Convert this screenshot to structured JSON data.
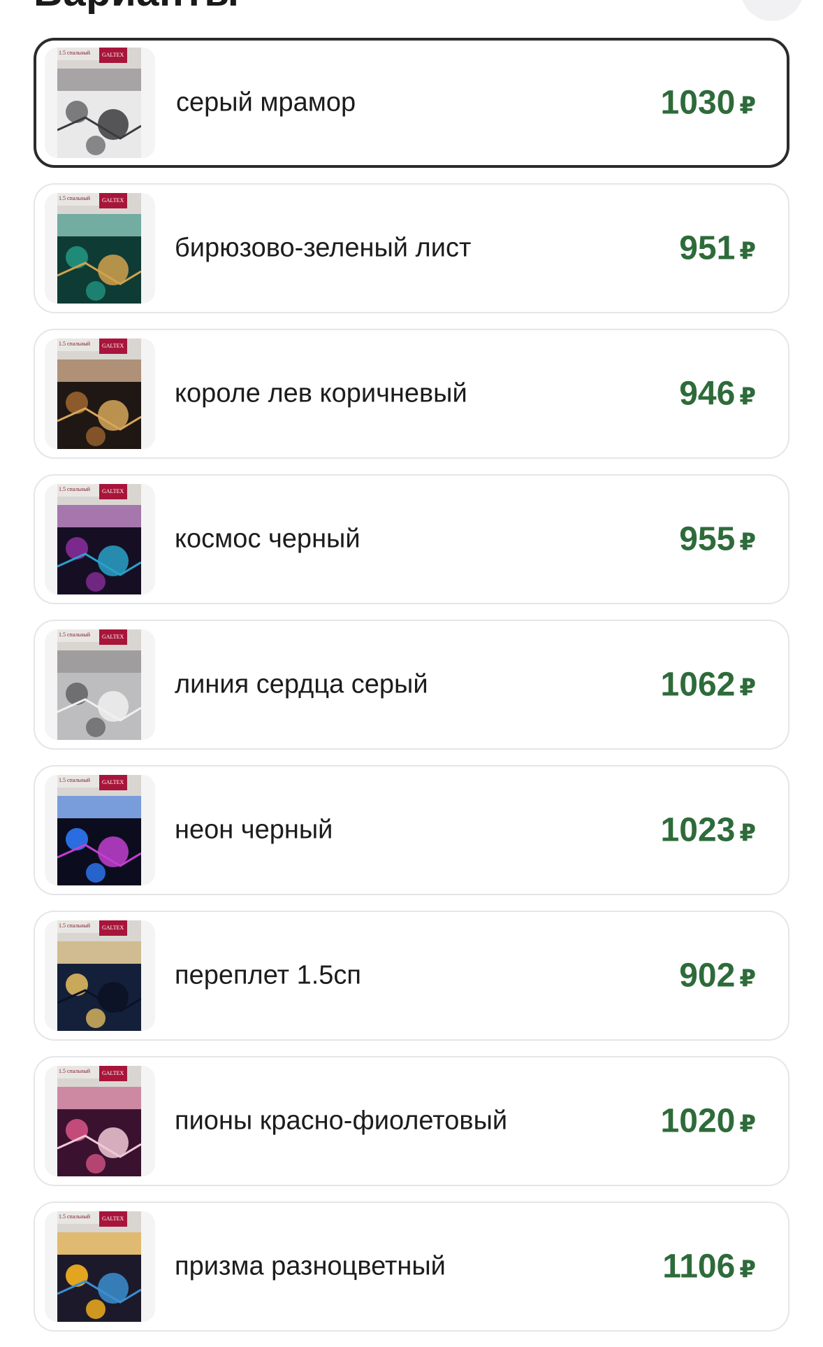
{
  "header": {
    "title": "Варианты"
  },
  "currency_symbol": "₽",
  "variants": [
    {
      "name": "серый мрамор",
      "price": "1030",
      "selected": true,
      "swatch": "gray-marble",
      "colors": [
        "#e9e9ea",
        "#7b7b7e",
        "#3b3b3e"
      ]
    },
    {
      "name": "бирюзово-зеленый лист",
      "price": "951",
      "selected": false,
      "swatch": "teal-leaf",
      "colors": [
        "#0f3b35",
        "#1f8a78",
        "#d2a24c"
      ]
    },
    {
      "name": "короле лев коричневый",
      "price": "946",
      "selected": false,
      "swatch": "lion-brown",
      "colors": [
        "#1f1714",
        "#8c5a2b",
        "#d7a75a"
      ]
    },
    {
      "name": "космос черный",
      "price": "955",
      "selected": false,
      "swatch": "cosmos-black",
      "colors": [
        "#160f24",
        "#7a2a8c",
        "#2aa1c9"
      ]
    },
    {
      "name": "линия сердца серый",
      "price": "1062",
      "selected": false,
      "swatch": "heart-gray",
      "colors": [
        "#bdbdbf",
        "#6f6f72",
        "#f0f0f0"
      ]
    },
    {
      "name": "неон черный",
      "price": "1023",
      "selected": false,
      "swatch": "neon-black",
      "colors": [
        "#0b0d1e",
        "#2a6de0",
        "#c23fd0"
      ]
    },
    {
      "name": "переплет 1.5сп",
      "price": "902",
      "selected": false,
      "swatch": "lattice-navy",
      "colors": [
        "#14203a",
        "#c9a85a",
        "#0b1224"
      ]
    },
    {
      "name": "пионы красно-фиолетовый",
      "price": "1020",
      "selected": false,
      "swatch": "peony-purple",
      "colors": [
        "#3a1230",
        "#c24b7a",
        "#f1c9d6"
      ]
    },
    {
      "name": "призма разноцветный",
      "price": "1106",
      "selected": false,
      "swatch": "prism-multi",
      "colors": [
        "#1c1a2a",
        "#e3a41f",
        "#3b8fd1"
      ]
    }
  ],
  "product_image": {
    "brand_tag": "GALTEX",
    "size_tag": "1.5 спальный"
  },
  "colors": {
    "price": "#2e6b3a",
    "selected_border": "#2b2b2b",
    "card_border": "#e6e6e8"
  }
}
